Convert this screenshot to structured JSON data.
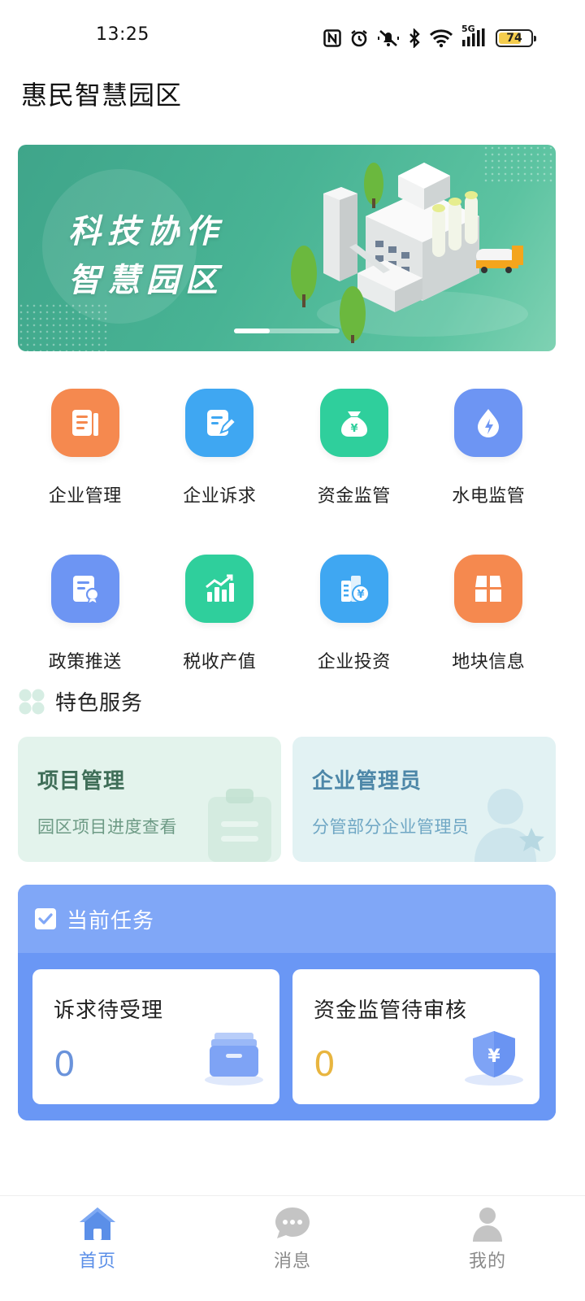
{
  "status_bar": {
    "time": "13:25",
    "network_label": "5G",
    "battery_level": "74",
    "icons": [
      "nfc-icon",
      "alarm-icon",
      "mute-icon",
      "bluetooth-icon",
      "wifi-icon",
      "signal-icon",
      "battery-icon"
    ]
  },
  "header": {
    "title": "惠民智慧园区"
  },
  "banner": {
    "line1": "科技协作",
    "line2": "智慧园区",
    "slide_index": 1,
    "slide_count": 3
  },
  "menu": {
    "items": [
      {
        "label": "企业管理",
        "icon": "document-icon",
        "color": "#f5894f"
      },
      {
        "label": "企业诉求",
        "icon": "edit-icon",
        "color": "#3fa7f2"
      },
      {
        "label": "资金监管",
        "icon": "money-bag-icon",
        "color": "#2fcf9c"
      },
      {
        "label": "水电监管",
        "icon": "water-drop-icon",
        "color": "#6d95f3"
      },
      {
        "label": "政策推送",
        "icon": "certificate-icon",
        "color": "#6d95f3"
      },
      {
        "label": "税收产值",
        "icon": "chart-icon",
        "color": "#2fcf9c"
      },
      {
        "label": "企业投资",
        "icon": "building-yen-icon",
        "color": "#3fa7f2"
      },
      {
        "label": "地块信息",
        "icon": "land-block-icon",
        "color": "#f5894f"
      }
    ]
  },
  "features": {
    "section_title": "特色服务",
    "cards": [
      {
        "title": "项目管理",
        "subtitle": "园区项目进度查看"
      },
      {
        "title": "企业管理员",
        "subtitle": "分管部分企业管理员"
      }
    ]
  },
  "tasks": {
    "title": "当前任务",
    "cards": [
      {
        "label": "诉求待受理",
        "count": "0"
      },
      {
        "label": "资金监管待审核",
        "count": "0"
      }
    ]
  },
  "nav": {
    "items": [
      {
        "label": "首页",
        "active": true
      },
      {
        "label": "消息",
        "active": false
      },
      {
        "label": "我的",
        "active": false
      }
    ]
  },
  "colors": {
    "primary": "#6a97f5",
    "active_nav": "#5b8fe8",
    "banner_green": "#48b394"
  }
}
